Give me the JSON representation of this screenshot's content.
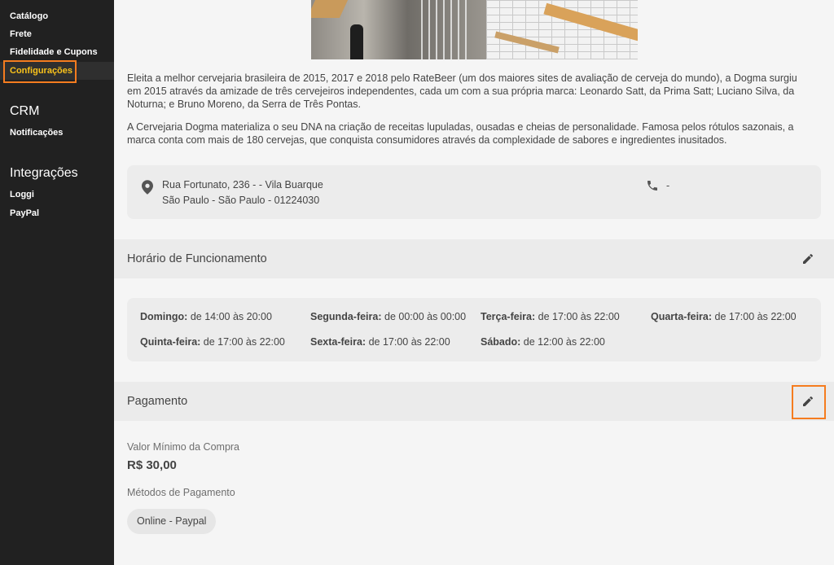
{
  "sidebar": {
    "items_top": [
      "Catálogo",
      "Frete",
      "Fidelidade e Cupons",
      "Configurações"
    ],
    "crm_heading": "CRM",
    "crm_items": [
      "Notificações"
    ],
    "integrations_heading": "Integrações",
    "integration_items": [
      "Loggi",
      "PayPal"
    ],
    "accent_color": "#f9c21b"
  },
  "about": {
    "paragraph_1": "Eleita a melhor cervejaria brasileira de 2015, 2017 e 2018 pelo RateBeer (um dos maiores sites de avaliação de cerveja do mundo), a Dogma surgiu em 2015 através da amizade de três cervejeiros independentes, cada um com a sua própria marca: Leonardo Satt, da Prima Satt; Luciano Silva, da Noturna; e Bruno Moreno, da Serra de Três Pontas.",
    "paragraph_2": "A Cervejaria Dogma materializa o seu DNA na criação de receitas lupuladas, ousadas e cheias de personalidade. Famosa pelos rótulos sazonais, a marca conta com mais de 180 cervejas, que conquista consumidores através da complexidade de sabores e ingredientes inusitados."
  },
  "address": {
    "line1": "Rua Fortunato, 236 - - Vila Buarque",
    "line2": "São Paulo - São Paulo - 01224030",
    "phone": "-"
  },
  "hours": {
    "title": "Horário de Funcionamento",
    "days": [
      {
        "day": "Domingo:",
        "time": "de 14:00 às 20:00"
      },
      {
        "day": "Segunda-feira:",
        "time": "de 00:00 às 00:00"
      },
      {
        "day": "Terça-feira:",
        "time": "de 17:00 às 22:00"
      },
      {
        "day": "Quarta-feira:",
        "time": "de 17:00 às 22:00"
      },
      {
        "day": "Quinta-feira:",
        "time": "de 17:00 às 22:00"
      },
      {
        "day": "Sexta-feira:",
        "time": "de 17:00 às 22:00"
      },
      {
        "day": "Sábado:",
        "time": "de 12:00 às 22:00"
      }
    ]
  },
  "payment": {
    "title": "Pagamento",
    "min_label": "Valor Mínimo da Compra",
    "min_value": "R$ 30,00",
    "methods_label": "Métodos de Pagamento",
    "methods": [
      "Online - Paypal"
    ]
  },
  "icons": [
    "location-pin-icon",
    "phone-icon",
    "pencil-edit-icon"
  ],
  "highlight_color": "#f57c1f"
}
